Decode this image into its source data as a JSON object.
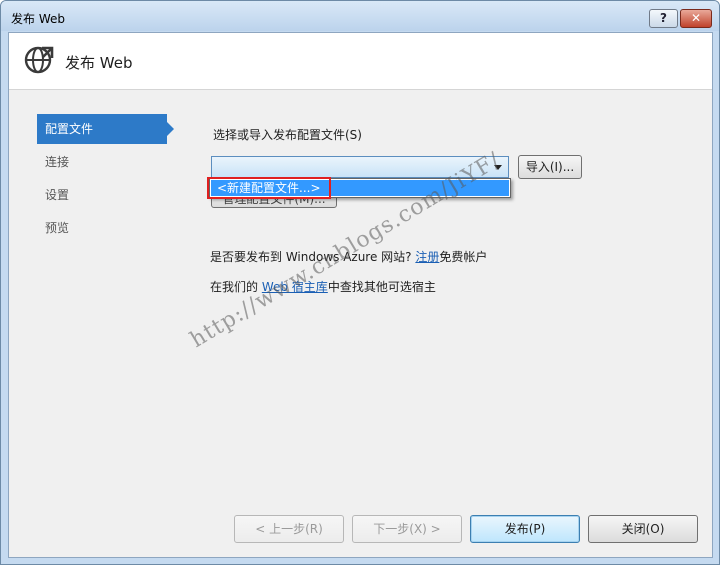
{
  "window": {
    "title": "发布 Web",
    "help_label": "?",
    "close_label": "✕"
  },
  "header": {
    "title": "发布 Web",
    "icon": "globe-publish-icon"
  },
  "sidebar": {
    "items": [
      {
        "label": "配置文件",
        "active": true
      },
      {
        "label": "连接",
        "active": false
      },
      {
        "label": "设置",
        "active": false
      },
      {
        "label": "预览",
        "active": false
      }
    ]
  },
  "profile": {
    "select_label": "选择或导入发布配置文件(S)",
    "combo_value": "",
    "dropdown_option": "<新建配置文件...>",
    "import_button": "导入(I)...",
    "manage_button_partial": "管理配置文件(M)..."
  },
  "azure": {
    "prefix": "是否要发布到 Windows Azure 网站? ",
    "register_link": "注册",
    "suffix": "免费帐户"
  },
  "hosting": {
    "prefix": "在我们的 ",
    "link": "Web 宿主库",
    "suffix": "中查找其他可选宿主"
  },
  "watermark": "http://www.cnblogs.com/JiYF/",
  "footer": {
    "prev_button": "< 上一步(R)",
    "next_button": "下一步(X) >",
    "publish_button": "发布(P)",
    "close_button": "关闭(O)"
  },
  "colors": {
    "accent": "#2d7ac8",
    "selection": "#3399ff",
    "highlight_box": "#e02020",
    "link": "#1a5fb4"
  }
}
